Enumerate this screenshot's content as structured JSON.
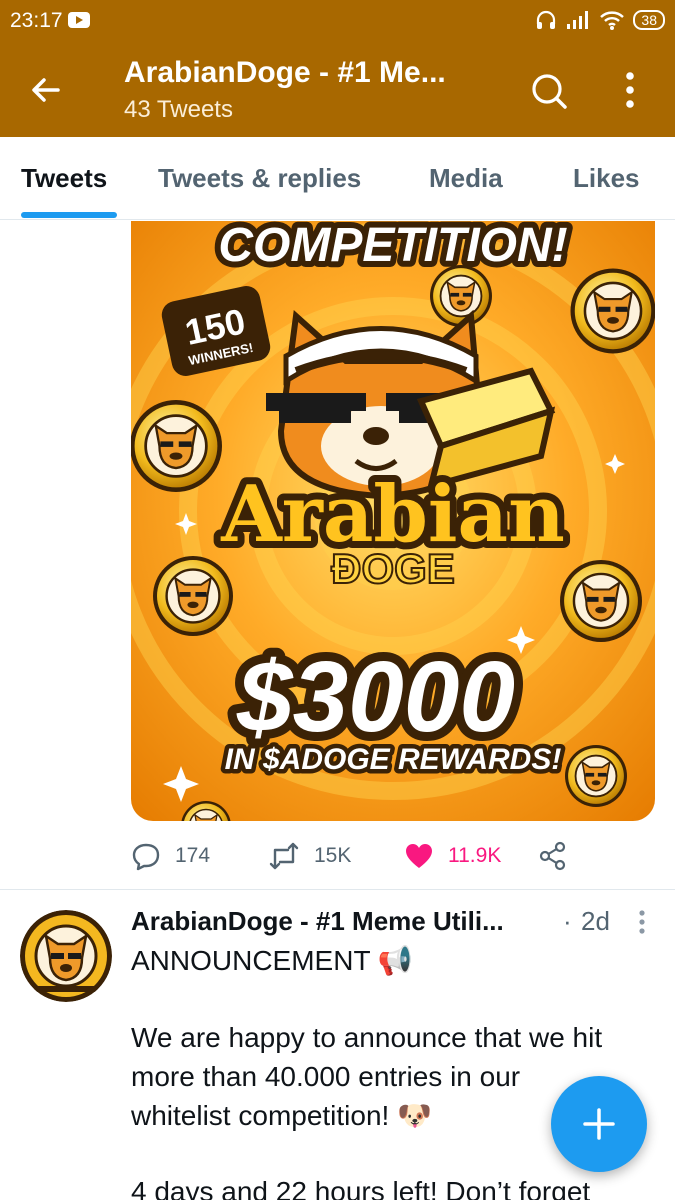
{
  "status_bar": {
    "time": "23:17",
    "battery": "38"
  },
  "header": {
    "title": "ArabianDoge - #1 Me...",
    "subtitle": "43 Tweets"
  },
  "tabs": [
    {
      "label": "Tweets",
      "active": true
    },
    {
      "label": "Tweets & replies",
      "active": false
    },
    {
      "label": "Media",
      "active": false
    },
    {
      "label": "Likes",
      "active": false
    }
  ],
  "media": {
    "headline": "COMPETITION!",
    "winners_count": "150",
    "winners_label": "WINNERS!",
    "brand_top": "Arabian",
    "brand_bottom": "ĐOGE",
    "amount": "$3000",
    "rewards": "IN $ADOGE REWARDS!"
  },
  "tweet1_actions": {
    "replies": "174",
    "retweets": "15K",
    "likes": "11.9K"
  },
  "tweet2": {
    "author": "ArabianDoge - #1 Meme Utili...",
    "separator": "·",
    "time": "2d",
    "lines": [
      "ANNOUNCEMENT 📢",
      "We are happy to announce that we hit",
      "more than 40.000 entries in our",
      "whitelist competition! 🐶",
      "4 days and 22 hours left! Don’t forget"
    ]
  },
  "colors": {
    "brand": "#a86800",
    "accent": "#1d9bf0",
    "like": "#f91880",
    "muted": "#536471"
  },
  "icons": [
    "back-arrow-icon",
    "search-icon",
    "more-vertical-icon",
    "reply-icon",
    "retweet-icon",
    "heart-icon",
    "share-icon",
    "compose-plus-icon"
  ]
}
